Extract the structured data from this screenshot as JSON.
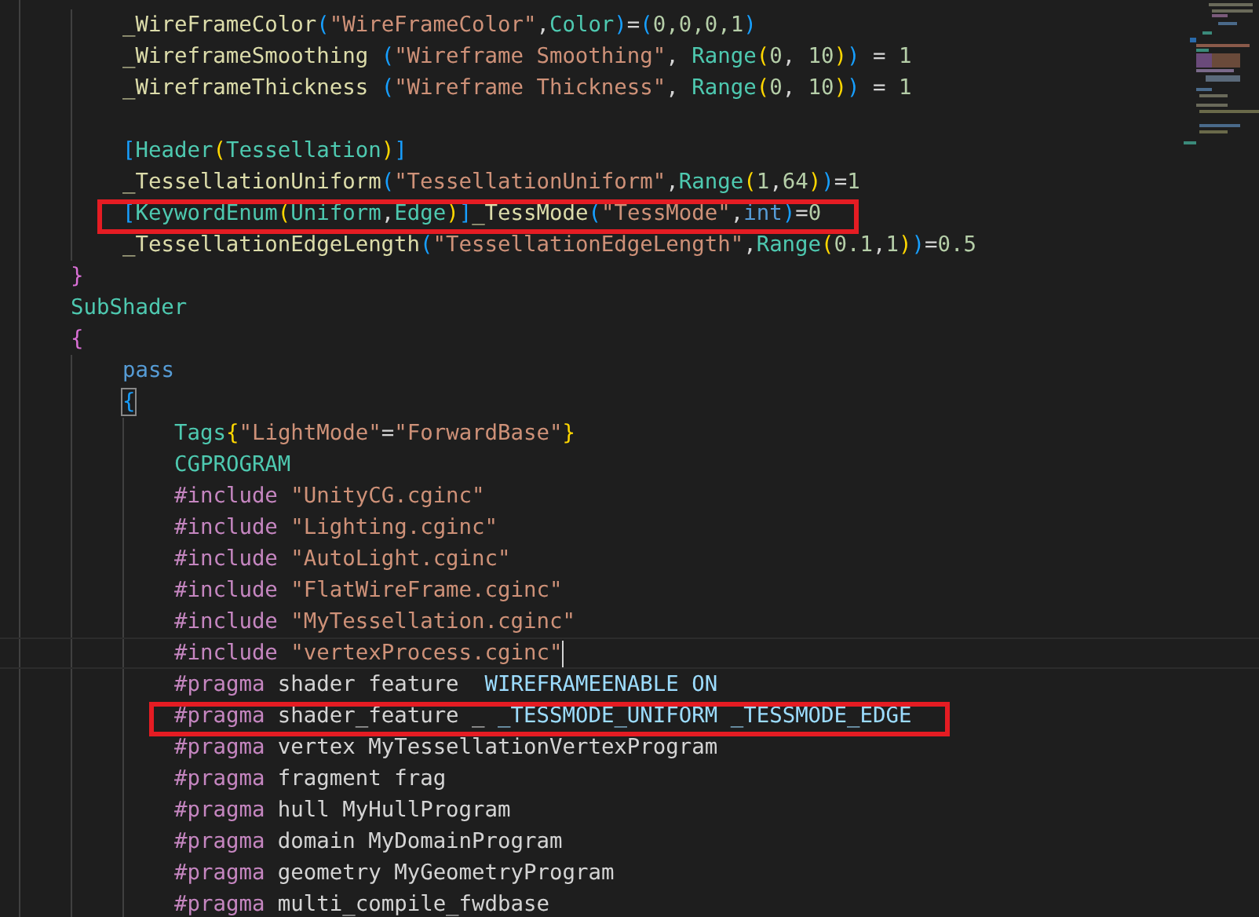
{
  "editor": {
    "lines": [
      {
        "children": [
          {
            "tokens": [
              {
                "kind": "id",
                "text": "_WireFrameColor"
              },
              {
                "kind": "b1",
                "text": "("
              },
              {
                "kind": "str",
                "text": "\"WireFrameColor\""
              },
              {
                "kind": "plain",
                "text": ","
              },
              {
                "kind": "type",
                "text": "Color"
              },
              {
                "kind": "b1",
                "text": ")"
              },
              {
                "kind": "plain",
                "text": "="
              },
              {
                "kind": "b1",
                "text": "("
              },
              {
                "kind": "num",
                "text": "0,0,0,1"
              },
              {
                "kind": "b1",
                "text": ")"
              }
            ]
          },
          {
            "tokens": [
              {
                "kind": "id",
                "text": "_WireframeSmoothing "
              },
              {
                "kind": "b1",
                "text": "("
              },
              {
                "kind": "str",
                "text": "\"Wireframe Smoothing\""
              },
              {
                "kind": "plain",
                "text": ", "
              },
              {
                "kind": "type",
                "text": "Range"
              },
              {
                "kind": "b2",
                "text": "("
              },
              {
                "kind": "num",
                "text": "0"
              },
              {
                "kind": "plain",
                "text": ", "
              },
              {
                "kind": "num",
                "text": "10"
              },
              {
                "kind": "b2",
                "text": ")"
              },
              {
                "kind": "b1",
                "text": ")"
              },
              {
                "kind": "plain",
                "text": " = "
              },
              {
                "kind": "num",
                "text": "1"
              }
            ]
          },
          {
            "tokens": [
              {
                "kind": "id",
                "text": "_WireframeThickness "
              },
              {
                "kind": "b1",
                "text": "("
              },
              {
                "kind": "str",
                "text": "\"Wireframe Thickness\""
              },
              {
                "kind": "plain",
                "text": ", "
              },
              {
                "kind": "type",
                "text": "Range"
              },
              {
                "kind": "b2",
                "text": "("
              },
              {
                "kind": "num",
                "text": "0"
              },
              {
                "kind": "plain",
                "text": ", "
              },
              {
                "kind": "num",
                "text": "10"
              },
              {
                "kind": "b2",
                "text": ")"
              },
              {
                "kind": "b1",
                "text": ")"
              },
              {
                "kind": "plain",
                "text": " = "
              },
              {
                "kind": "num",
                "text": "1"
              }
            ]
          },
          {
            "blank": true
          },
          {
            "tokens": [
              {
                "kind": "b1",
                "text": "["
              },
              {
                "kind": "type",
                "text": "Header"
              },
              {
                "kind": "b2",
                "text": "("
              },
              {
                "kind": "type",
                "text": "Tessellation"
              },
              {
                "kind": "b2",
                "text": ")"
              },
              {
                "kind": "b1",
                "text": "]"
              }
            ]
          },
          {
            "tokens": [
              {
                "kind": "id",
                "text": "_TessellationUniform"
              },
              {
                "kind": "b1",
                "text": "("
              },
              {
                "kind": "str",
                "text": "\"TessellationUniform\""
              },
              {
                "kind": "plain",
                "text": ","
              },
              {
                "kind": "type",
                "text": "Range"
              },
              {
                "kind": "b2",
                "text": "("
              },
              {
                "kind": "num",
                "text": "1"
              },
              {
                "kind": "plain",
                "text": ","
              },
              {
                "kind": "num",
                "text": "64"
              },
              {
                "kind": "b2",
                "text": ")"
              },
              {
                "kind": "b1",
                "text": ")"
              },
              {
                "kind": "plain",
                "text": "="
              },
              {
                "kind": "num",
                "text": "1"
              }
            ]
          },
          {
            "highlighted": true,
            "tokens": [
              {
                "kind": "b1",
                "text": "["
              },
              {
                "kind": "type",
                "text": "KeywordEnum"
              },
              {
                "kind": "b2",
                "text": "("
              },
              {
                "kind": "type",
                "text": "Uniform"
              },
              {
                "kind": "plain",
                "text": ","
              },
              {
                "kind": "type",
                "text": "Edge"
              },
              {
                "kind": "b2",
                "text": ")"
              },
              {
                "kind": "b1",
                "text": "]"
              },
              {
                "kind": "id",
                "text": "_TessMode"
              },
              {
                "kind": "b1",
                "text": "("
              },
              {
                "kind": "str",
                "text": "\"TessMode\""
              },
              {
                "kind": "plain",
                "text": ","
              },
              {
                "kind": "kw",
                "text": "int"
              },
              {
                "kind": "b1",
                "text": ")"
              },
              {
                "kind": "plain",
                "text": "="
              },
              {
                "kind": "num",
                "text": "0"
              }
            ]
          },
          {
            "tokens": [
              {
                "kind": "id",
                "text": "_TessellationEdgeLength"
              },
              {
                "kind": "b1",
                "text": "("
              },
              {
                "kind": "str",
                "text": "\"TessellationEdgeLength\""
              },
              {
                "kind": "plain",
                "text": ","
              },
              {
                "kind": "type",
                "text": "Range"
              },
              {
                "kind": "b2",
                "text": "("
              },
              {
                "kind": "num",
                "text": "0.1"
              },
              {
                "kind": "plain",
                "text": ","
              },
              {
                "kind": "num",
                "text": "1"
              },
              {
                "kind": "b2",
                "text": ")"
              },
              {
                "kind": "b1",
                "text": ")"
              },
              {
                "kind": "plain",
                "text": "="
              },
              {
                "kind": "num",
                "text": "0.5"
              }
            ]
          }
        ]
      },
      {
        "tokens": [
          {
            "kind": "b3",
            "text": "}"
          }
        ]
      },
      {
        "tokens": [
          {
            "kind": "type",
            "text": "SubShader"
          }
        ]
      },
      {
        "tokens": [
          {
            "kind": "b3",
            "text": "{"
          }
        ],
        "children": [
          {
            "tokens": [
              {
                "kind": "kw",
                "text": "pass"
              }
            ]
          },
          {
            "tokens": [
              {
                "kind": "b1",
                "text": "{",
                "matched": true
              }
            ],
            "children": [
              {
                "tokens": [
                  {
                    "kind": "type",
                    "text": "Tags"
                  },
                  {
                    "kind": "b2",
                    "text": "{"
                  },
                  {
                    "kind": "str",
                    "text": "\"LightMode\""
                  },
                  {
                    "kind": "plain",
                    "text": "="
                  },
                  {
                    "kind": "str",
                    "text": "\"ForwardBase\""
                  },
                  {
                    "kind": "b2",
                    "text": "}"
                  }
                ]
              },
              {
                "tokens": [
                  {
                    "kind": "type",
                    "text": "CGPROGRAM"
                  }
                ]
              },
              {
                "tokens": [
                  {
                    "kind": "dir",
                    "text": "#include "
                  },
                  {
                    "kind": "str",
                    "text": "\"UnityCG.cginc\""
                  }
                ]
              },
              {
                "tokens": [
                  {
                    "kind": "dir",
                    "text": "#include "
                  },
                  {
                    "kind": "str",
                    "text": "\"Lighting.cginc\""
                  }
                ]
              },
              {
                "tokens": [
                  {
                    "kind": "dir",
                    "text": "#include "
                  },
                  {
                    "kind": "str",
                    "text": "\"AutoLight.cginc\""
                  }
                ]
              },
              {
                "tokens": [
                  {
                    "kind": "dir",
                    "text": "#include "
                  },
                  {
                    "kind": "str",
                    "text": "\"FlatWireFrame.cginc\""
                  }
                ]
              },
              {
                "tokens": [
                  {
                    "kind": "dir",
                    "text": "#include "
                  },
                  {
                    "kind": "str",
                    "text": "\"MyTessellation.cginc\""
                  }
                ]
              },
              {
                "cursor": true,
                "tokens": [
                  {
                    "kind": "dir",
                    "text": "#include "
                  },
                  {
                    "kind": "str",
                    "text": "\"vertexProcess.cginc\""
                  }
                ]
              },
              {
                "tokens": [
                  {
                    "kind": "dir",
                    "text": "#pragma"
                  },
                  {
                    "kind": "plain",
                    "text": " shader feature  "
                  },
                  {
                    "kind": "macro",
                    "text": "WIREFRAMEENABLE ON"
                  }
                ]
              },
              {
                "highlighted": true,
                "tokens": [
                  {
                    "kind": "dir",
                    "text": "#pragma"
                  },
                  {
                    "kind": "plain",
                    "text": " shader_feature _ "
                  },
                  {
                    "kind": "macro",
                    "text": "_TESSMODE_UNIFORM _TESSMODE_EDGE"
                  }
                ]
              },
              {
                "tokens": [
                  {
                    "kind": "dir",
                    "text": "#pragma"
                  },
                  {
                    "kind": "plain",
                    "text": " vertex MyTessellationVertexProgram"
                  }
                ]
              },
              {
                "tokens": [
                  {
                    "kind": "dir",
                    "text": "#pragma"
                  },
                  {
                    "kind": "plain",
                    "text": " fragment frag"
                  }
                ]
              },
              {
                "tokens": [
                  {
                    "kind": "dir",
                    "text": "#pragma"
                  },
                  {
                    "kind": "plain",
                    "text": " hull MyHullProgram"
                  }
                ]
              },
              {
                "tokens": [
                  {
                    "kind": "dir",
                    "text": "#pragma"
                  },
                  {
                    "kind": "plain",
                    "text": " domain MyDomainProgram"
                  }
                ]
              },
              {
                "tokens": [
                  {
                    "kind": "dir",
                    "text": "#pragma"
                  },
                  {
                    "kind": "plain",
                    "text": " geometry MyGeometryProgram"
                  }
                ]
              },
              {
                "tokens": [
                  {
                    "kind": "dir",
                    "text": "#pragma"
                  },
                  {
                    "kind": "plain",
                    "text": " multi_compile_fwdbase"
                  }
                ]
              }
            ]
          }
        ]
      }
    ]
  }
}
